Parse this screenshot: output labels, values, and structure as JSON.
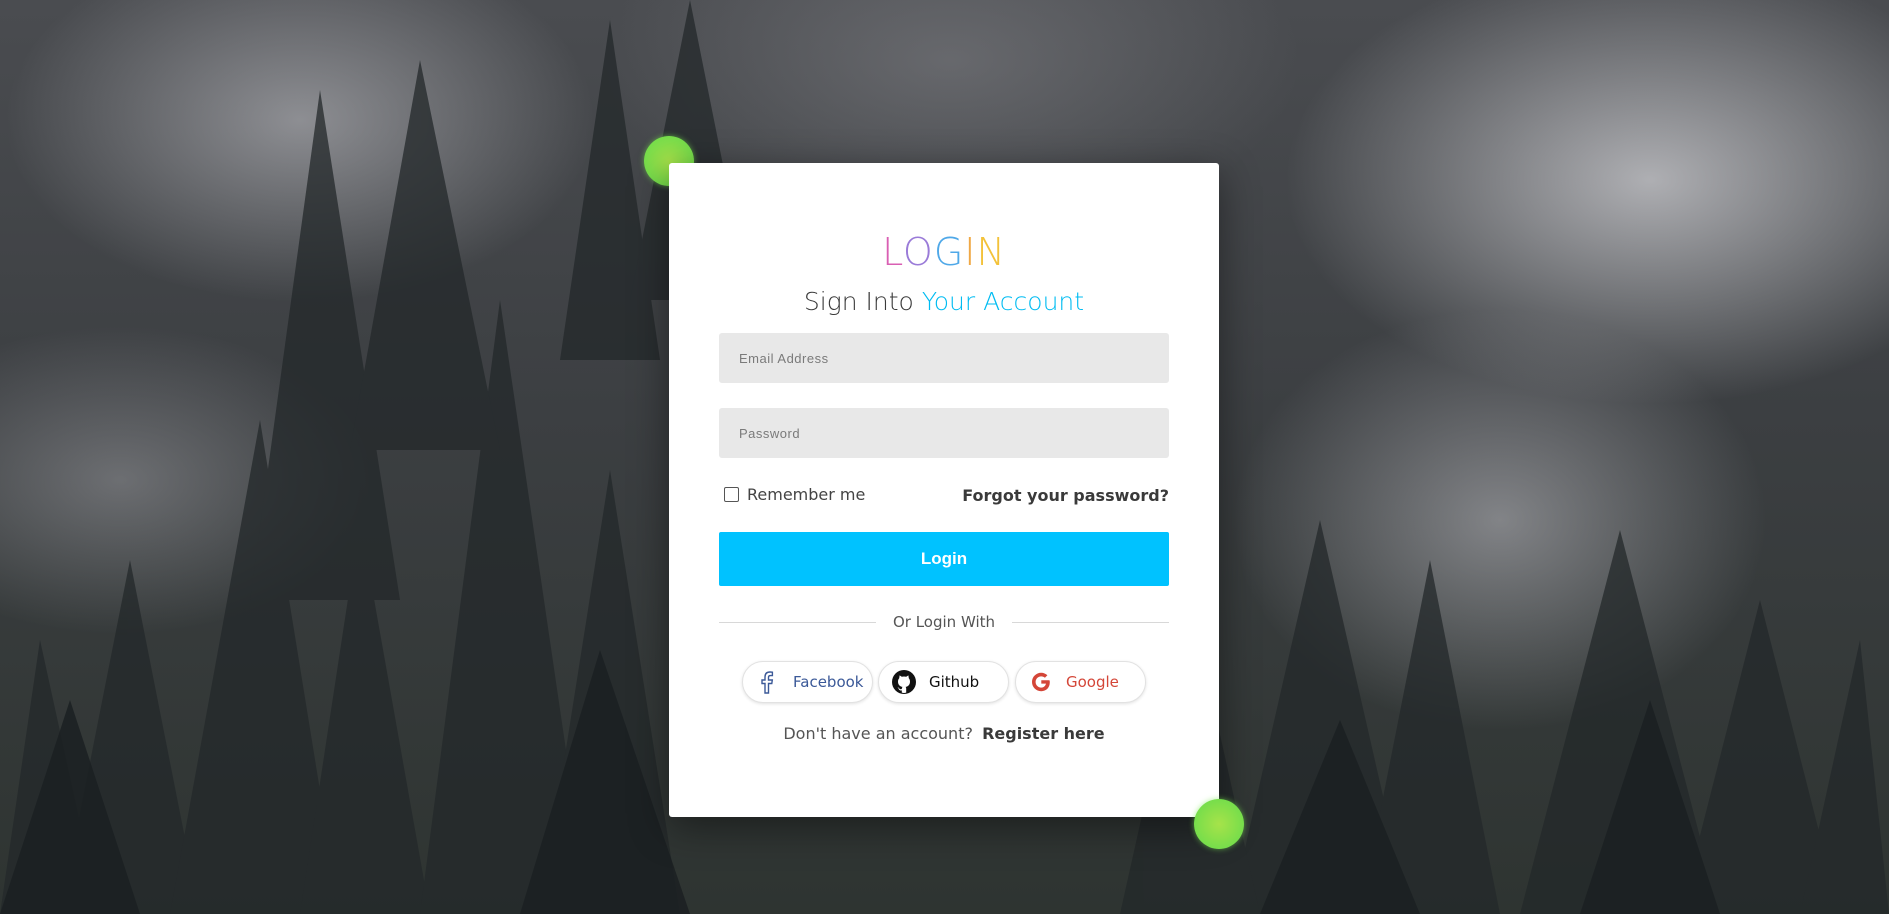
{
  "logo": {
    "letters": [
      "L",
      "O",
      "G",
      "I",
      "N"
    ],
    "colors": [
      "#d95fb3",
      "#9a7bd8",
      "#4fa8e8",
      "#f0a845",
      "#f3c23a"
    ]
  },
  "subtitle": {
    "prefix": "Sign Into",
    "accent": "Your Account",
    "accent_color": "#00bcf2"
  },
  "form": {
    "email_placeholder": "Email Address",
    "password_placeholder": "Password",
    "remember_label": "Remember me",
    "forgot_label": "Forgot your password?",
    "login_label": "Login",
    "login_color": "#00c2ff"
  },
  "social": {
    "divider_text": "Or Login With",
    "buttons": [
      {
        "label": "Facebook",
        "icon": "facebook-icon",
        "color": "#3b5998"
      },
      {
        "label": "Github",
        "icon": "github-icon",
        "color": "#111111"
      },
      {
        "label": "Google",
        "icon": "google-icon",
        "color": "#d44638"
      }
    ]
  },
  "register": {
    "prompt": "Don't have an account?",
    "link": "Register here"
  },
  "decor": {
    "dot_color": "#8fe04a"
  }
}
